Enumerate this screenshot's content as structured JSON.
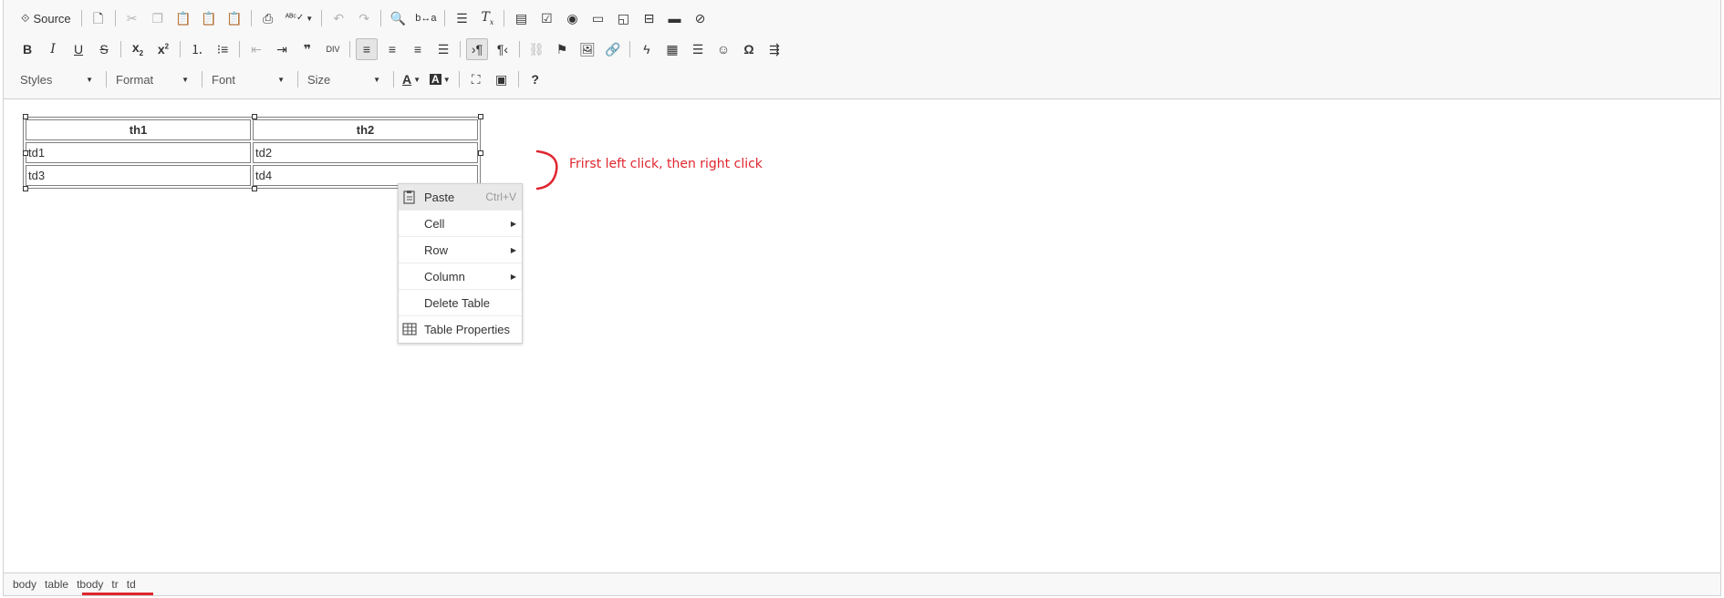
{
  "toolbar": {
    "source_label": "Source",
    "combos": [
      {
        "label": "Styles"
      },
      {
        "label": "Format"
      },
      {
        "label": "Font"
      },
      {
        "label": "Size"
      }
    ]
  },
  "table": {
    "headers": [
      "th1",
      "th2"
    ],
    "rows": [
      [
        "td1",
        "td2"
      ],
      [
        "td3",
        "td4"
      ]
    ]
  },
  "annotation": {
    "text": "Frirst left click, then right click",
    "color": "#e0262f"
  },
  "context_menu": {
    "items": [
      {
        "label": "Paste",
        "shortcut": "Ctrl+V",
        "icon": "paste-icon"
      },
      {
        "label": "Cell",
        "submenu": true
      },
      {
        "label": "Row",
        "submenu": true
      },
      {
        "label": "Column",
        "submenu": true
      },
      {
        "label": "Delete Table"
      },
      {
        "label": "Table Properties",
        "icon": "table-icon"
      }
    ]
  },
  "statusbar": {
    "path": [
      "body",
      "table",
      "tbody",
      "tr",
      "td"
    ]
  }
}
